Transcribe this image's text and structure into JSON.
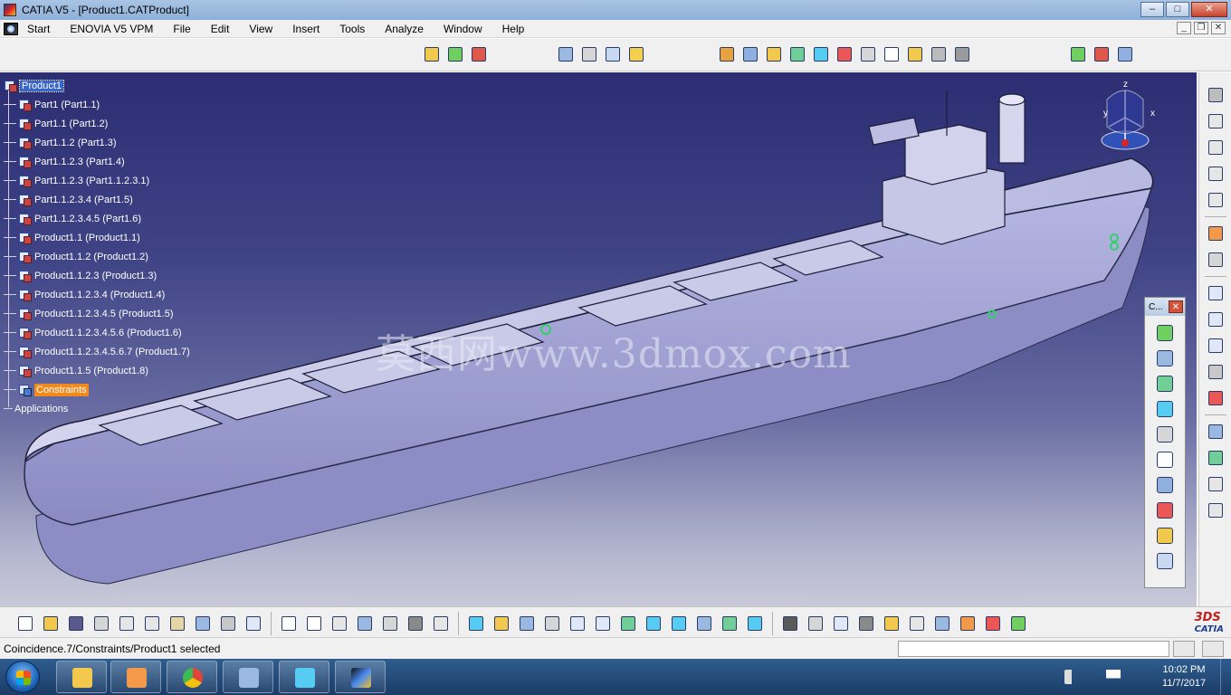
{
  "window": {
    "title": "CATIA V5 - [Product1.CATProduct]",
    "controls": [
      "–",
      "□",
      "✕"
    ]
  },
  "menubar": {
    "items": [
      "Start",
      "ENOVIA V5 VPM",
      "File",
      "Edit",
      "View",
      "Insert",
      "Tools",
      "Analyze",
      "Window",
      "Help"
    ],
    "mdi_controls": [
      "_",
      "❐",
      "✕"
    ]
  },
  "spec_tree": {
    "root": "Product1",
    "items": [
      "Part1 (Part1.1)",
      "Part1.1 (Part1.2)",
      "Part1.1.2 (Part1.3)",
      "Part1.1.2.3 (Part1.4)",
      "Part1.1.2.3 (Part1.1.2.3.1)",
      "Part1.1.2.3.4 (Part1.5)",
      "Part1.1.2.3.4.5 (Part1.6)",
      "Product1.1 (Product1.1)",
      "Product1.1.2 (Product1.2)",
      "Product1.1.2.3 (Product1.3)",
      "Product1.1.2.3.4 (Product1.4)",
      "Product1.1.2.3.4.5 (Product1.5)",
      "Product1.1.2.3.4.5.6 (Product1.6)",
      "Product1.1.2.3.4.5.6.7 (Product1.7)",
      "Product1.1.5 (Product1.8)"
    ],
    "constraints": "Constraints",
    "applications": "Applications"
  },
  "compass": {
    "x": "x",
    "y": "y",
    "z": "z"
  },
  "watermark": "莫西网www.3dmox.com",
  "floating_toolbar": {
    "title": "C...",
    "close": "✕"
  },
  "statusbar": {
    "message": "Coincidence.7/Constraints/Product1 selected",
    "command_value": ""
  },
  "branding": {
    "ds": "3DS",
    "name": "CATIA"
  },
  "taskbar": {
    "time": "10:02 PM",
    "date": "11/7/2017"
  },
  "colors": {
    "viewport_top": "#2c2d72",
    "viewport_bottom": "#c8c9d8",
    "hull": "#9a9bd0",
    "selection": "#f08a1c"
  }
}
